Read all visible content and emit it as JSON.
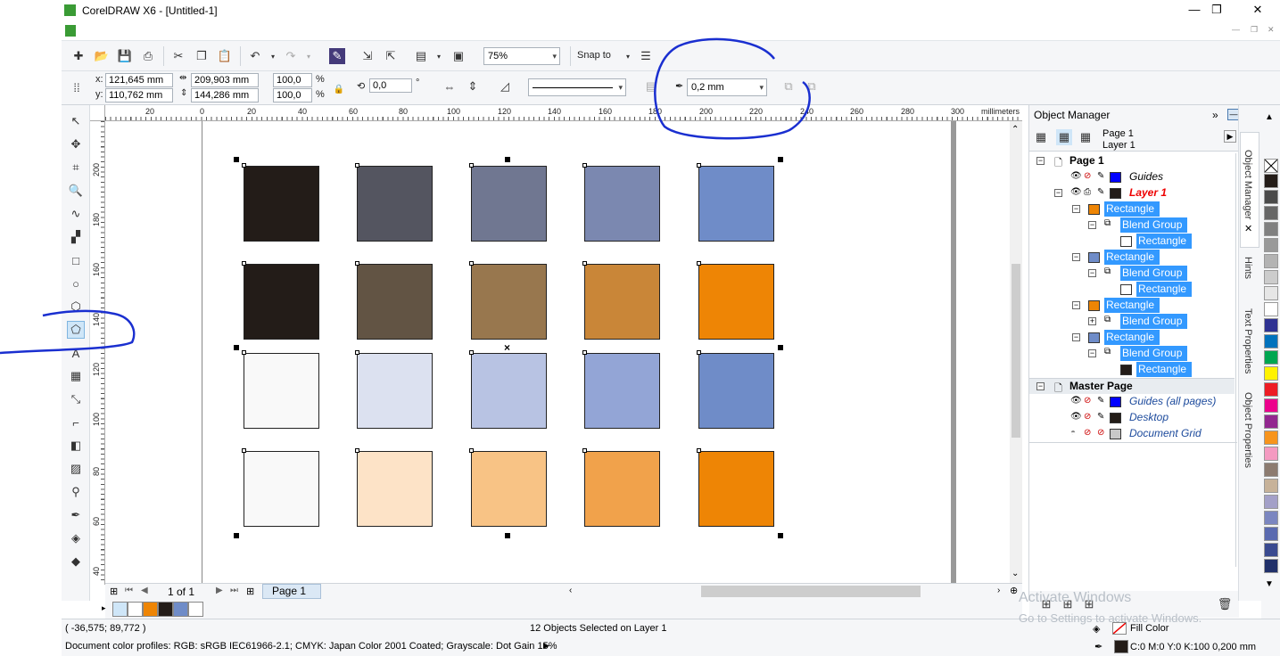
{
  "window": {
    "title": "CorelDRAW X6 - [Untitled-1]",
    "minimize": "—",
    "maximize": "❐",
    "close": "✕"
  },
  "toolbar": {
    "zoom": "75%",
    "snap_to": "Snap to",
    "outline_width": "0,2 mm"
  },
  "propbar": {
    "x_label": "x:",
    "x_value": "121,645 mm",
    "y_label": "y:",
    "y_value": "110,762 mm",
    "w_value": "209,903 mm",
    "h_value": "144,286 mm",
    "scale_w": "100,0",
    "scale_h": "100,0",
    "pct": "%",
    "rotation": "0,0",
    "degree": "°"
  },
  "ruler": {
    "unit": "millimeters",
    "h_ticks": [
      "20",
      "0",
      "20",
      "40",
      "60",
      "80",
      "100",
      "120",
      "140",
      "160",
      "180",
      "200",
      "220",
      "240",
      "260",
      "280",
      "300"
    ],
    "v_ticks": [
      "200",
      "180",
      "160",
      "140",
      "120",
      "100",
      "80",
      "60",
      "40",
      "millimeters"
    ]
  },
  "canvas": {
    "rows": [
      [
        "#231c18",
        "#545560",
        "#707791",
        "#7b88b0",
        "#6f8cc8"
      ],
      [
        "#231c18",
        "#625444",
        "#98774e",
        "#c98638",
        "#ee8505"
      ],
      [
        "#f9f9f9",
        "#dce1f0",
        "#b8c3e3",
        "#93a5d6",
        "#6f8cc8"
      ],
      [
        "#f9f9f9",
        "#fde3c7",
        "#f8c385",
        "#f1a24b",
        "#ee8505"
      ]
    ],
    "center_mark": "×"
  },
  "page_nav": {
    "counter": "1 of 1",
    "page_tab": "Page 1"
  },
  "status": {
    "coords": "( -36,575; 89,772 )",
    "selection": "12 Objects Selected on Layer 1",
    "profiles": "Document color profiles: RGB: sRGB IEC61966-2.1; CMYK: Japan Color 2001 Coated; Grayscale: Dot Gain 15%",
    "fill_label": "Fill Color",
    "outline_info": "C:0 M:0 Y:0 K:100  0,200 mm"
  },
  "object_manager": {
    "title": "Object Manager",
    "page": "Page 1",
    "layer": "Layer 1",
    "tree_page": "Page 1",
    "guides": "Guides",
    "layer1": "Layer 1",
    "items": [
      {
        "label": "Rectangle",
        "depth": 0,
        "color": "#ee8505"
      },
      {
        "label": "Blend Group",
        "depth": 1
      },
      {
        "label": "Rectangle",
        "depth": 2,
        "color": "#ffffff"
      },
      {
        "label": "Rectangle",
        "depth": 0,
        "color": "#6f8cc8"
      },
      {
        "label": "Blend Group",
        "depth": 1
      },
      {
        "label": "Rectangle",
        "depth": 2,
        "color": "#ffffff"
      },
      {
        "label": "Rectangle",
        "depth": 0,
        "color": "#ee8505"
      },
      {
        "label": "Blend Group",
        "depth": 1
      },
      {
        "label": "Rectangle",
        "depth": 0,
        "color": "#6f8cc8"
      },
      {
        "label": "Blend Group",
        "depth": 1
      },
      {
        "label": "Rectangle",
        "depth": 2,
        "color": "#231c18"
      }
    ],
    "master_page": "Master Page",
    "guides_all": "Guides (all pages)",
    "desktop": "Desktop",
    "doc_grid": "Document Grid"
  },
  "dock_tabs": {
    "object_manager": "Object Manager",
    "hints": "Hints",
    "text_props": "Text Properties",
    "object_props": "Object Properties"
  },
  "palette": [
    "#231c18",
    "#4a4a4a",
    "#666666",
    "#808080",
    "#999999",
    "#b3b3b3",
    "#cccccc",
    "#e6e6e6",
    "#ffffff",
    "#2e3192",
    "#0072bc",
    "#00a651",
    "#fff200",
    "#ed1c24",
    "#ec008c",
    "#92278f",
    "#f7941d",
    "#f49ac1",
    "#8c7b70",
    "#c7b299",
    "#a3a0c8",
    "#7b86c0",
    "#5a6ab0",
    "#3a4a90",
    "#20306a"
  ],
  "watermark": {
    "line1": "Activate Windows",
    "line2": "Go to Settings to activate Windows."
  }
}
